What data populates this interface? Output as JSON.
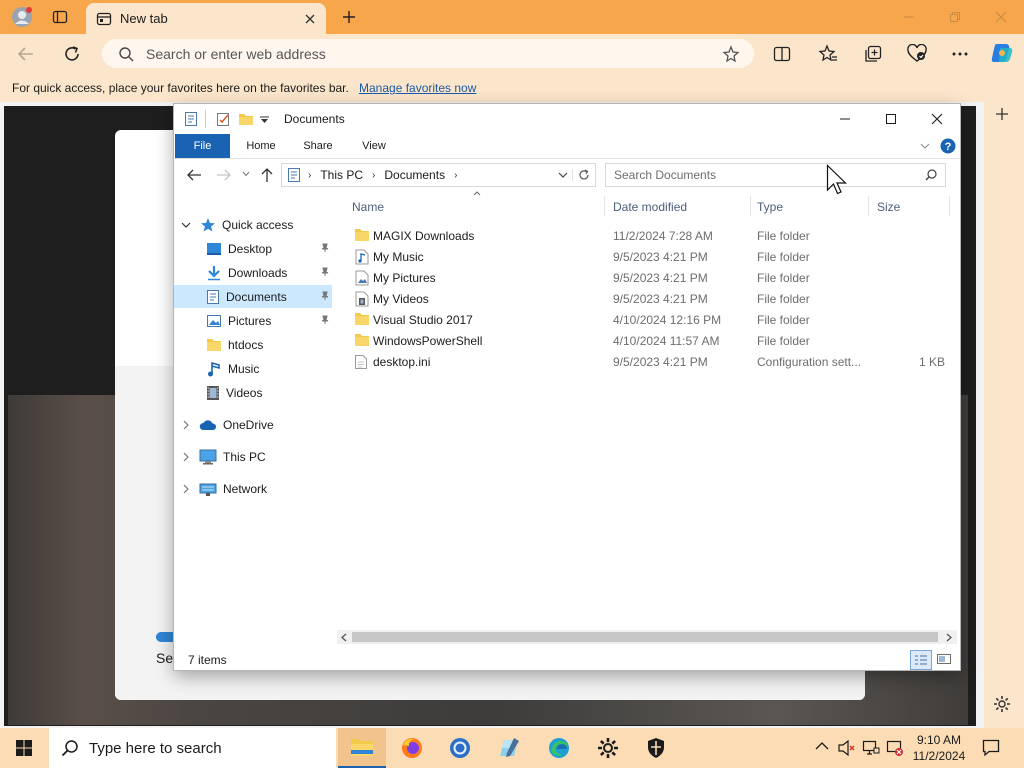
{
  "browser": {
    "tab_title": "New tab",
    "address_placeholder": "Search or enter web address",
    "favorites_bar_text": "For quick access, place your favorites here on the favorites bar.",
    "favorites_bar_link": "Manage favorites now"
  },
  "web_content": {
    "partial_text": "Sel"
  },
  "explorer": {
    "title": "Documents",
    "ribbon_tabs": [
      "File",
      "Home",
      "Share",
      "View"
    ],
    "breadcrumb": [
      "This PC",
      "Documents"
    ],
    "search_placeholder": "Search Documents",
    "nav": {
      "quick_access": "Quick access",
      "quick_items": [
        "Desktop",
        "Downloads",
        "Documents",
        "Pictures",
        "htdocs",
        "Music",
        "Videos"
      ],
      "onedrive": "OneDrive",
      "this_pc": "This PC",
      "network": "Network"
    },
    "columns": {
      "name": "Name",
      "date": "Date modified",
      "type": "Type",
      "size": "Size"
    },
    "files": [
      {
        "name": "MAGIX Downloads",
        "date": "11/2/2024 7:28 AM",
        "type": "File folder",
        "size": "",
        "icon": "folder-icon"
      },
      {
        "name": "My Music",
        "date": "9/5/2023 4:21 PM",
        "type": "File folder",
        "size": "",
        "icon": "music-folder-icon"
      },
      {
        "name": "My Pictures",
        "date": "9/5/2023 4:21 PM",
        "type": "File folder",
        "size": "",
        "icon": "pictures-folder-icon"
      },
      {
        "name": "My Videos",
        "date": "9/5/2023 4:21 PM",
        "type": "File folder",
        "size": "",
        "icon": "videos-folder-icon"
      },
      {
        "name": "Visual Studio 2017",
        "date": "4/10/2024 12:16 PM",
        "type": "File folder",
        "size": "",
        "icon": "folder-icon"
      },
      {
        "name": "WindowsPowerShell",
        "date": "4/10/2024 11:57 AM",
        "type": "File folder",
        "size": "",
        "icon": "folder-icon"
      },
      {
        "name": "desktop.ini",
        "date": "9/5/2023 4:21 PM",
        "type": "Configuration sett...",
        "size": "1 KB",
        "icon": "config-file-icon"
      }
    ],
    "status_count": "7 items"
  },
  "taskbar": {
    "search_placeholder": "Type here to search",
    "time": "9:10 AM",
    "date": "11/2/2024"
  },
  "colors": {
    "browser_titlebar": "#f7a64c",
    "browser_toolbar": "#fbe6cc",
    "selection": "#cce8ff",
    "file_tab": "#1a63b3",
    "folder": "#f3c94a",
    "taskbar": "#fbdcb4"
  }
}
